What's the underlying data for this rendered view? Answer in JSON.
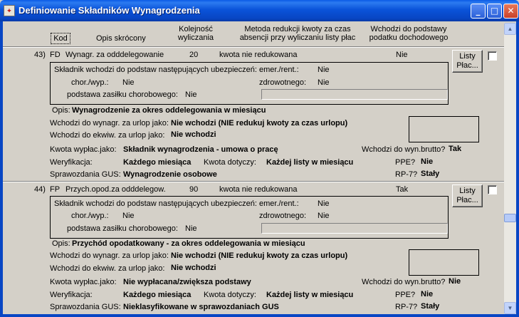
{
  "window": {
    "title": "Definiowanie Składników Wynagrodzenia",
    "minimize": "_",
    "maximize": "□",
    "close": "✕"
  },
  "header": {
    "kod": "Kod",
    "opis": "Opis skrócony",
    "kolejnosc_1": "Kolejność",
    "kolejnosc_2": "wyliczania",
    "metoda_1": "Metoda redukcji kwoty za czas",
    "metoda_2": "absencji przy wyliczaniu listy płac",
    "wchodzi_1": "Wchodzi do podstawy",
    "wchodzi_2": "podatku dochodowego"
  },
  "labels": {
    "ubezp_title": "Składnik wchodzi do podstaw następujących ubezpieczeń:",
    "emer": "emer./rent.:",
    "chor": "chor./wyp.:",
    "zdrow": "zdrowotnego:",
    "zasilek": "podstawa zasiłku chorobowego:",
    "opis": "Opis:",
    "urlop": "Wchodzi do wynagr. za urlop jako:",
    "ekwiw": "Wchodzi do ekwiw. za urlop jako:",
    "kwota": "Kwota wypłac.jako:",
    "brutto": "Wchodzi do wyn.brutto?",
    "weryf": "Weryfikacja:",
    "dotyczy": "Kwota dotyczy:",
    "ppe": "PPE?",
    "gus": "Sprawozdania GUS:",
    "rp7": "RP-7?",
    "listy_btn": "Listy Płac..."
  },
  "records": [
    {
      "nr": "43)",
      "kod": "FD",
      "opis_skrocony": "Wynagr. za odddelegowanie",
      "kolejnosc": "20",
      "metoda": "kwota nie redukowana",
      "podatek": "Nie",
      "emer": "Nie",
      "chor": "Nie",
      "zdrow": "Nie",
      "zasilek": "Nie",
      "opis": "Wynagrodzenie za okres oddelegowania w miesiącu",
      "urlop": "Nie wchodzi  (NIE redukuj kwoty za czas urlopu)",
      "ekwiw": "Nie wchodzi",
      "kwota": "Składnik wynagrodzenia - umowa o pracę",
      "brutto": "Tak",
      "weryf": "Każdego miesiąca",
      "dotyczy": "Każdej listy w miesiącu",
      "ppe": "Nie",
      "gus": "Wynagrodzenie osobowe",
      "rp7": "Stały"
    },
    {
      "nr": "44)",
      "kod": "FP",
      "opis_skrocony": "Przych.opod.za odddelegow.",
      "kolejnosc": "90",
      "metoda": "kwota nie redukowana",
      "podatek": "Tak",
      "emer": "Nie",
      "chor": "Nie",
      "zdrow": "Nie",
      "zasilek": "Nie",
      "opis": "Przychód opodatkowany - za okres oddelegowania w miesiącu",
      "urlop": "Nie wchodzi  (NIE redukuj kwoty za czas urlopu)",
      "ekwiw": "Nie wchodzi",
      "kwota": "Nie wypłacana/zwiększa podstawy",
      "brutto": "Nie",
      "weryf": "Każdego miesiąca",
      "dotyczy": "Każdej listy w miesiącu",
      "ppe": "Nie",
      "gus": "Nieklasyfikowane w sprawozdaniach GUS",
      "rp7": "Stały"
    }
  ],
  "scrollbar": {
    "up": "▲",
    "down": "▼"
  }
}
